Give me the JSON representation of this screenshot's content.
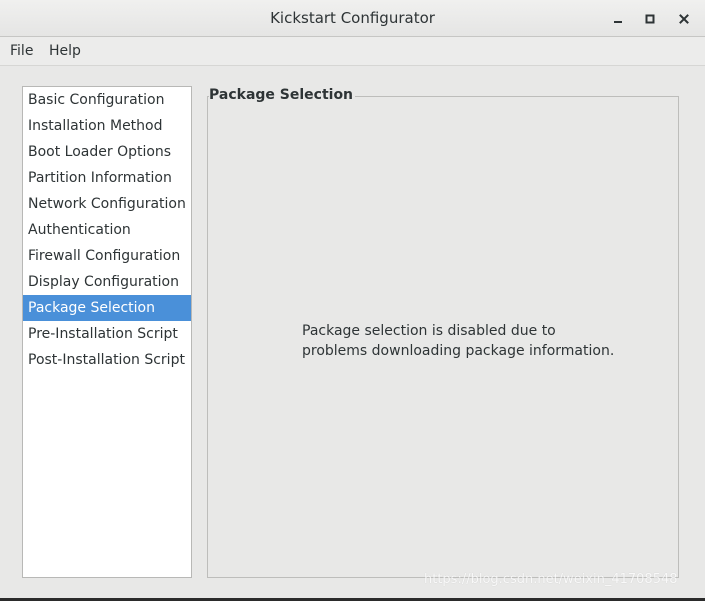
{
  "window": {
    "title": "Kickstart Configurator"
  },
  "menubar": {
    "file": "File",
    "help": "Help"
  },
  "sidebar": {
    "items": [
      {
        "label": "Basic Configuration"
      },
      {
        "label": "Installation Method"
      },
      {
        "label": "Boot Loader Options"
      },
      {
        "label": "Partition Information"
      },
      {
        "label": "Network Configuration"
      },
      {
        "label": "Authentication"
      },
      {
        "label": "Firewall Configuration"
      },
      {
        "label": "Display Configuration"
      },
      {
        "label": "Package Selection"
      },
      {
        "label": "Pre-Installation Script"
      },
      {
        "label": "Post-Installation Script"
      }
    ],
    "selected": "Package Selection",
    "selected_color": "#4a90d9"
  },
  "panel": {
    "title": "Package Selection",
    "message_line1": "Package selection is disabled due to",
    "message_line2": "problems downloading package information."
  },
  "watermark": "https://blog.csdn.net/weixin_41708548",
  "icons": {
    "minimize": "minimize-icon",
    "maximize": "maximize-icon",
    "close": "close-icon"
  }
}
